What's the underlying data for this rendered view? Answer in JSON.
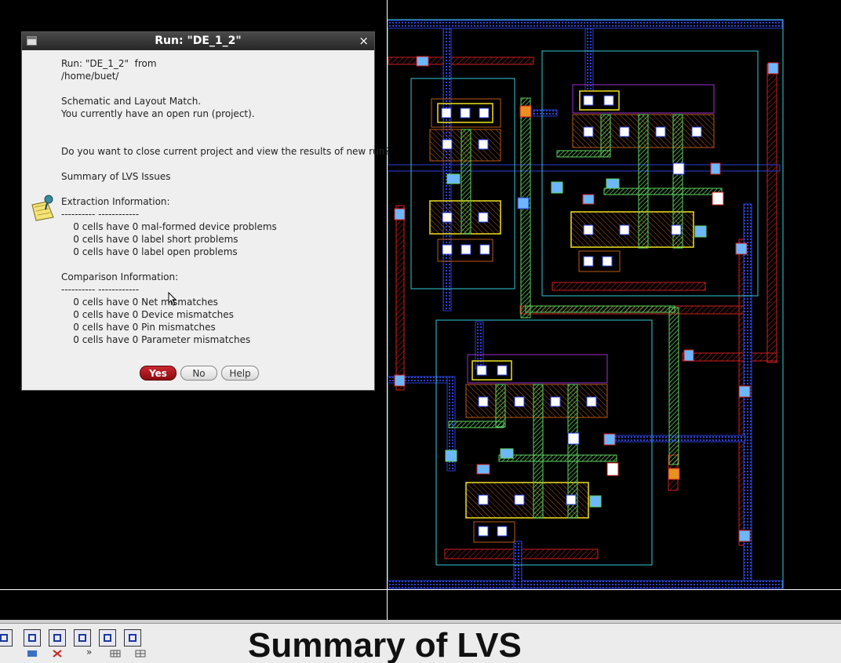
{
  "dialog": {
    "title": "Run: \"DE_1_2\"",
    "close_glyph": "×",
    "lines": [
      "Run: \"DE_1_2\"  from",
      "/home/buet/",
      "",
      "Schematic and Layout Match.",
      "You currently have an open run (project).",
      "",
      "",
      "Do you want to close current project and view the results of new run?",
      "",
      "Summary of LVS Issues",
      "",
      "Extraction Information:",
      "---------- ------------",
      "    0 cells have 0 mal-formed device problems",
      "    0 cells have 0 label short problems",
      "    0 cells have 0 label open problems",
      "",
      "Comparison Information:",
      "---------- ------------",
      "    0 cells have 0 Net mismatches",
      "    0 cells have 0 Device mismatches",
      "    0 cells have 0 Pin mismatches",
      "    0 cells have 0 Parameter mismatches"
    ],
    "buttons": {
      "yes": "Yes",
      "no": "No",
      "help": "Help"
    },
    "icon": "note-icon"
  },
  "caption": "Summary of LVS",
  "toolbar": {
    "icons": [
      "zoom-fit-icon",
      "select-box-icon",
      "zoom-in-icon",
      "zoom-out-icon",
      "pan-icon",
      "ruler-icon"
    ],
    "overflow_glyph": "»"
  },
  "colors": {
    "dialog_bg": "#efefef",
    "yes_button": "#b8171e",
    "canvas_bg": "#000000"
  }
}
